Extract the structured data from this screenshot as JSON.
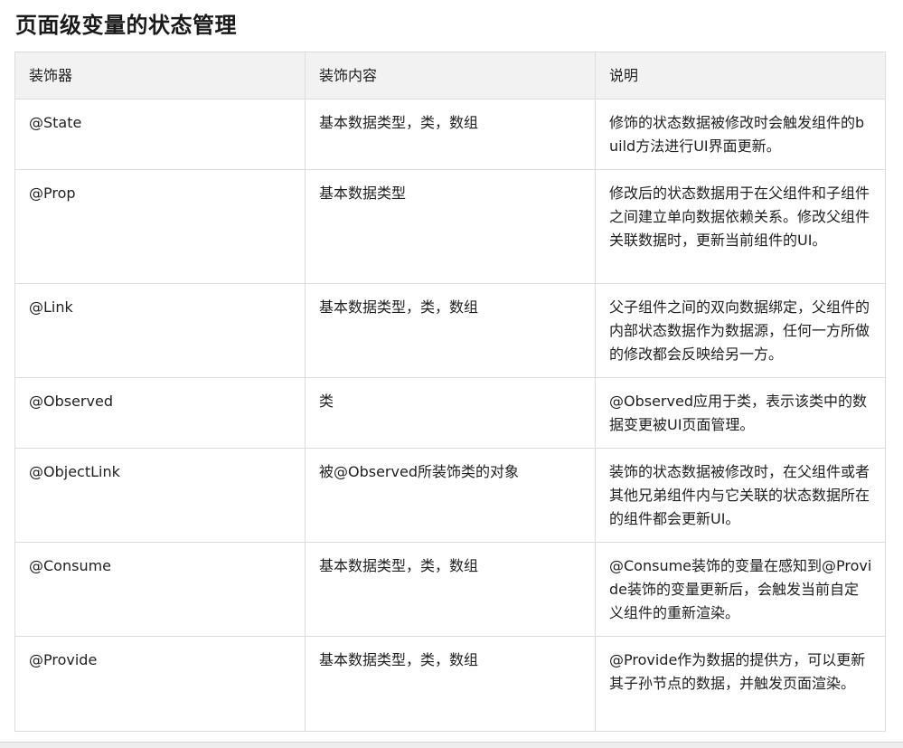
{
  "page": {
    "title": "页面级变量的状态管理"
  },
  "table": {
    "headers": [
      "装饰器",
      "装饰内容",
      "说明"
    ],
    "rows": [
      {
        "decorator": "@State",
        "content": "基本数据类型，类，数组",
        "description": "修饰的状态数据被修改时会触发组件的build方法进行UI界面更新。"
      },
      {
        "decorator": "@Prop",
        "content": "基本数据类型",
        "description": "修改后的状态数据用于在父组件和子组件之间建立单向数据依赖关系。修改父组件关联数据时，更新当前组件的UI。"
      },
      {
        "decorator": "@Link",
        "content": "基本数据类型，类，数组",
        "description": "父子组件之间的双向数据绑定，父组件的内部状态数据作为数据源，任何一方所做的修改都会反映给另一方。"
      },
      {
        "decorator": "@Observed",
        "content": "类",
        "description": "@Observed应用于类，表示该类中的数据变更被UI页面管理。"
      },
      {
        "decorator": "@ObjectLink",
        "content": "被@Observed所装饰类的对象",
        "description": "装饰的状态数据被修改时，在父组件或者其他兄弟组件内与它关联的状态数据所在的组件都会更新UI。"
      },
      {
        "decorator": "@Consume",
        "content": "基本数据类型，类，数组",
        "description": "@Consume装饰的变量在感知到@Provide装饰的变量更新后，会触发当前自定义组件的重新渲染。"
      },
      {
        "decorator": "@Provide",
        "content": "基本数据类型，类，数组",
        "description": "@Provide作为数据的提供方，可以更新其子孙节点的数据，并触发页面渲染。"
      }
    ]
  }
}
